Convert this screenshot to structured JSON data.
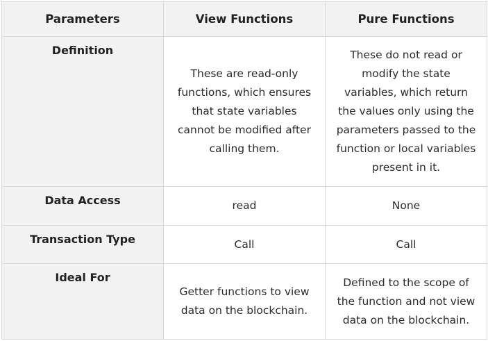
{
  "table": {
    "headers": [
      "Parameters",
      "View Functions",
      "Pure Functions"
    ],
    "rows": [
      {
        "label": "Definition",
        "view": "These are read-only functions, which ensures that state variables cannot be modified after calling them.",
        "pure": "These do not read or modify the state variables, which return the values only using the parameters passed to the function or local variables present in it."
      },
      {
        "label": "Data Access",
        "view": "read",
        "pure": "None"
      },
      {
        "label": "Transaction Type",
        "view": "Call",
        "pure": "Call"
      },
      {
        "label": "Ideal For",
        "view": "Getter functions to view data on the blockchain.",
        "pure": "Defined to the scope of the function and not view data on the blockchain."
      }
    ]
  },
  "colors": {
    "header_bg": "#f2f2f2",
    "border": "#d9d9d9",
    "text": "#222222"
  }
}
